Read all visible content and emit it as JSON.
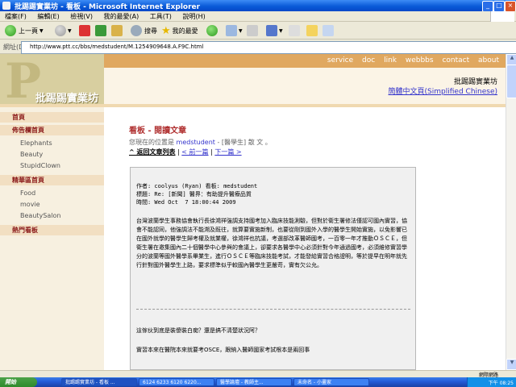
{
  "window": {
    "title": "批踢踢實業坊 - 看板 - Microsoft Internet Explorer",
    "minimize": "_",
    "maximize": "□",
    "close": "×"
  },
  "menu": [
    "檔案(F)",
    "編輯(E)",
    "檢視(V)",
    "我的最愛(A)",
    "工具(T)",
    "說明(H)"
  ],
  "toolbar": {
    "back_label": "上一頁",
    "search_label": "搜尋",
    "favorites_label": "我的最愛"
  },
  "address": {
    "label": "網址(D)",
    "url": "http://www.ptt.cc/bbs/medstudent/M.1254909648.A.F9C.html"
  },
  "site": {
    "logo_text": "批踢踢實業坊",
    "top_nav": [
      "service",
      "doc",
      "link",
      "webbbs",
      "contact",
      "about"
    ],
    "site_name": "批踢踢實業坊",
    "simplified_link": "簡體中文頁(Simplified Chinese)"
  },
  "sidebar": {
    "home": "首頁",
    "board_section": "佈告欄首頁",
    "boards": [
      "Elephants",
      "Beauty",
      "StupidClown"
    ],
    "essence_section": "精華區首頁",
    "essence": [
      "Food",
      "movie",
      "BeautySalon"
    ],
    "hot": "熱門看板"
  },
  "main": {
    "heading": "看板 - 閱讀文章",
    "breadcrumb_prefix": "您現在的位置是",
    "breadcrumb_board": "medstudent",
    "breadcrumb_sep": " - ",
    "breadcrumb_tag": "[醫學生]",
    "breadcrumb_suffix": " 散 文 。",
    "back_to_list": "^ 返回文章列表",
    "prev": "< 前一篇",
    "next": "下一篇 >"
  },
  "article": {
    "header": "作者: coolyus (Ryan) 看板: medstudent\n標題: Re: [新聞] 醫界：有助提升醫療品質\n時間: Wed Oct  7 18:00:44 2009",
    "body": "台灣波蘭學生事務協會執行長徐鴻祥強調支持國考加入臨床技能測驗，但對於衛生署修法僅認可國內實習，協會不能認同，他強調法不能溯及既往，就算要實施新制，也要從剛到國外入學的醫學生開始實施，以免影響已在國外就學的醫學生歸考權及就業權，徐鴻祥也抗議，考選部改革醫師國考，一百零一年才推動ＯＳＣＥ，但衛生署在邀集國內二十個醫學中心參與的會議上，卻要求各醫學中心必須針對今年通過國考，必須維修實習學分的波蘭等國外醫學系畢業生，進行ＯＳＣＥ等臨床技能考試，才能發給實習合格證明，等於提早在明年就先行針對國外醫學生上路，要求標準似乎較國內醫學生更嚴苛，實有欠公允。",
    "question": "這傢伙到底是裝傻裝白痴？還是搞不清楚狀況阿？",
    "reply": "實習本來在醫院本來就要考OSCE，跟納入醫師國家考試根本是兩回事"
  },
  "status": {
    "zone": "網際網路"
  },
  "taskbar": {
    "start": "開始",
    "tasks": [
      "批踢踢實業坊 - 看板 ...",
      "6124 6233 6120 6220...",
      "醫學論壇 - 教師主...",
      "未命名 - 小畫家"
    ],
    "clock": "下午 08:25"
  }
}
